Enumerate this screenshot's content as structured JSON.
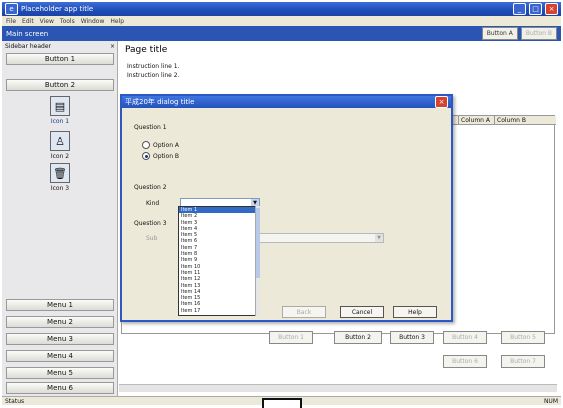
{
  "window": {
    "title": "Placeholder app title",
    "controls": {
      "minimize": "_",
      "maximize": "□",
      "close": "×"
    }
  },
  "menubar": {
    "items": [
      "File",
      "Edit",
      "View",
      "Tools",
      "Window",
      "Help"
    ]
  },
  "appbar": {
    "title": "Main screen",
    "buttons": [
      {
        "label": "Button A"
      },
      {
        "label": "Button B",
        "disabled": true
      }
    ]
  },
  "sidebar": {
    "header": "Sidebar header",
    "close": "×",
    "top_button": "Button 1",
    "create_button": "Button 2",
    "icons": [
      {
        "label": "Icon 1",
        "icon": "document-icon"
      },
      {
        "label": "Icon 2",
        "icon": "user-icon"
      },
      {
        "label": "Icon 3",
        "icon": "trash-icon"
      }
    ],
    "bottom_buttons": [
      "Menu 1",
      "Menu 2",
      "Menu 3",
      "Menu 4",
      "Menu 5",
      "Menu 6"
    ]
  },
  "main": {
    "title": "Page title",
    "line1": "Instruction line 1.",
    "line2": "Instruction line 2.",
    "columns": [
      {
        "label": "Column A"
      },
      {
        "label": "Column B"
      }
    ],
    "buttons": [
      {
        "label": "Button 1",
        "disabled": true
      },
      {
        "label": "Button 2",
        "disabled": false
      },
      {
        "label": "Button 3",
        "disabled": false
      },
      {
        "label": "Button 4",
        "disabled": true
      },
      {
        "label": "Button 5",
        "disabled": true
      }
    ],
    "buttons_row2": [
      {
        "label": "Button 6",
        "disabled": true
      },
      {
        "label": "Button 7",
        "disabled": true
      }
    ]
  },
  "dialog": {
    "title": "平成20年 dialog title",
    "question1": "Question 1",
    "radios": [
      {
        "label": "Option A",
        "selected": false
      },
      {
        "label": "Option B",
        "selected": true
      }
    ],
    "question2": "Question 2",
    "kind_label": "Kind",
    "kind_value": "",
    "question3": "Question 3",
    "sub_label": "Sub",
    "buttons": {
      "back": "Back",
      "next": "Next",
      "cancel": "Cancel",
      "help": "Help"
    },
    "dropdown_items": [
      "Item 1",
      "Item 2",
      "Item 3",
      "Item 4",
      "Item 5",
      "Item 6",
      "Item 7",
      "Item 8",
      "Item 9",
      "Item 10",
      "Item 11",
      "Item 12",
      "Item 13",
      "Item 14",
      "Item 15",
      "Item 16",
      "Item 17"
    ],
    "dropdown_selected_index": 0
  },
  "statusbar": {
    "left": "Status",
    "right": "NUM"
  },
  "colors": {
    "titlebar": "#2452bb",
    "appbar": "#2a55b3",
    "selection": "#316ac5",
    "close_button": "#d8412f"
  }
}
